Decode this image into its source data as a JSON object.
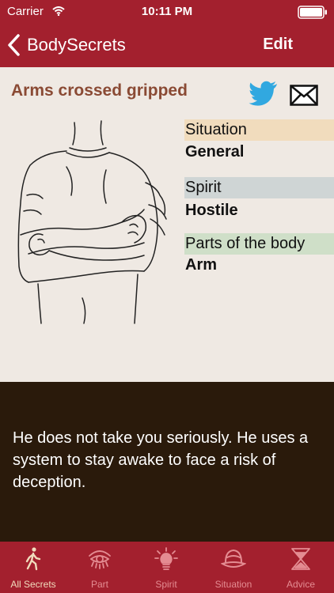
{
  "status_bar": {
    "carrier": "Carrier",
    "time": "10:11 PM"
  },
  "nav": {
    "back_label": "BodySecrets",
    "edit_label": "Edit"
  },
  "secret": {
    "title": "Arms crossed gripped",
    "attributes": {
      "situation": {
        "header": "Situation",
        "value": "General"
      },
      "spirit": {
        "header": "Spirit",
        "value": "Hostile"
      },
      "parts": {
        "header": "Parts of the body",
        "value": "Arm"
      }
    },
    "description": "He does not take you seriously. He uses a system to stay awake to face a risk of deception."
  },
  "icons": {
    "share_twitter": "twitter-icon",
    "share_mail": "mail-icon",
    "back": "chevron-left-icon"
  },
  "colors": {
    "brand": "#a3202e",
    "background": "#efe9e3",
    "title": "#8a4a34",
    "situation_bg": "#f1dcbd",
    "spirit_bg": "#cfd5d5",
    "parts_bg": "#cfdfc8",
    "description_bg": "#2a1a0b",
    "twitter_blue": "#31a8e0",
    "tab_active": "#f1dcbd",
    "tab_inactive": "#e48c92"
  },
  "tabs": [
    {
      "label": "All Secrets",
      "icon": "walking-person-icon",
      "active": true
    },
    {
      "label": "Part",
      "icon": "eye-icon",
      "active": false
    },
    {
      "label": "Spirit",
      "icon": "lightbulb-icon",
      "active": false
    },
    {
      "label": "Situation",
      "icon": "hat-icon",
      "active": false
    },
    {
      "label": "Advice",
      "icon": "hourglass-icon",
      "active": false
    }
  ]
}
